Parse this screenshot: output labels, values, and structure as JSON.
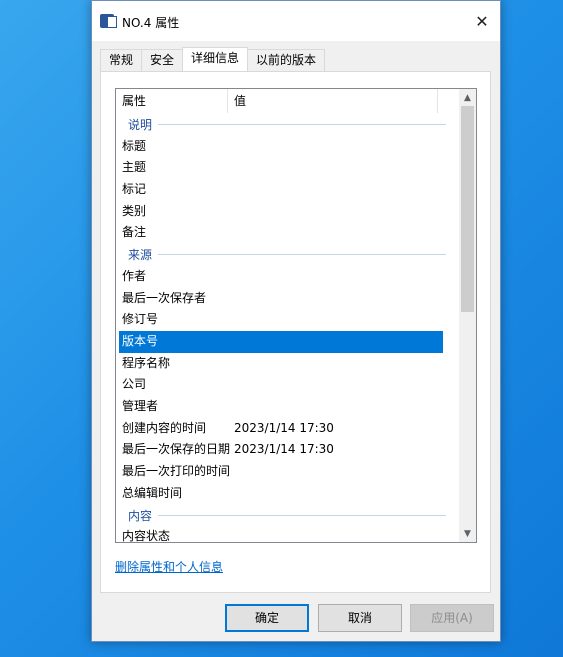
{
  "window": {
    "title": "NO.4 属性",
    "close_glyph": "✕"
  },
  "tabs": [
    {
      "label": "常规",
      "active": false
    },
    {
      "label": "安全",
      "active": false
    },
    {
      "label": "详细信息",
      "active": true
    },
    {
      "label": "以前的版本",
      "active": false
    }
  ],
  "list": {
    "headers": {
      "name": "属性",
      "value": "值"
    },
    "groups": {
      "description": "说明",
      "origin": "来源",
      "content": "内容"
    },
    "rows": {
      "title": {
        "name": "标题",
        "value": ""
      },
      "subject": {
        "name": "主题",
        "value": ""
      },
      "tags": {
        "name": "标记",
        "value": ""
      },
      "category": {
        "name": "类别",
        "value": ""
      },
      "comments": {
        "name": "备注",
        "value": ""
      },
      "author": {
        "name": "作者",
        "value": ""
      },
      "last_saved_by": {
        "name": "最后一次保存者",
        "value": ""
      },
      "revision": {
        "name": "修订号",
        "value": ""
      },
      "version": {
        "name": "版本号",
        "value": ""
      },
      "program": {
        "name": "程序名称",
        "value": ""
      },
      "company": {
        "name": "公司",
        "value": ""
      },
      "manager": {
        "name": "管理者",
        "value": ""
      },
      "created": {
        "name": "创建内容的时间",
        "value": "2023/1/14 17:30"
      },
      "last_saved": {
        "name": "最后一次保存的日期",
        "value": "2023/1/14 17:30"
      },
      "last_printed": {
        "name": "最后一次打印的时间",
        "value": ""
      },
      "edit_time": {
        "name": "总编辑时间",
        "value": ""
      },
      "content_status": {
        "name": "内容状态",
        "value": ""
      }
    },
    "selected_row": "版本号",
    "scroll_up_glyph": "▲",
    "scroll_down_glyph": "▼"
  },
  "remove_link": "删除属性和个人信息",
  "buttons": {
    "ok": "确定",
    "cancel": "取消",
    "apply": "应用(A)"
  },
  "colors": {
    "selection": "#0078d7",
    "link": "#0066cc",
    "group_text": "#1e4e9b"
  }
}
